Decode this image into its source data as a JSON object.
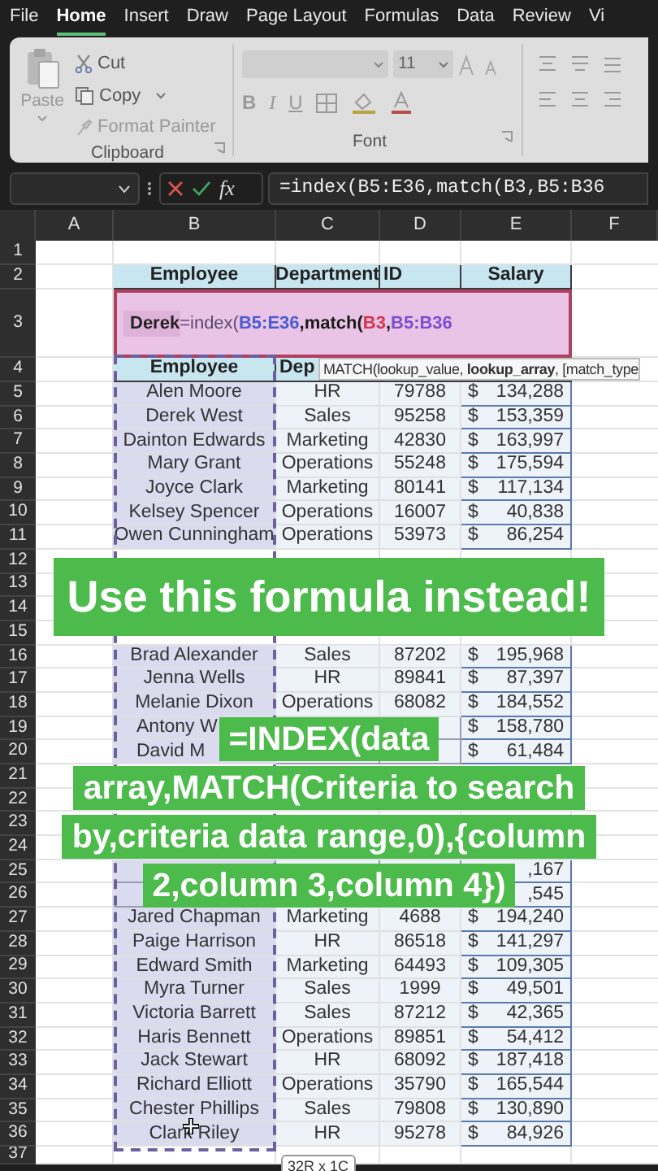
{
  "menu_tabs": [
    {
      "label": "File",
      "selected": false
    },
    {
      "label": "Home",
      "selected": true
    },
    {
      "label": "Insert",
      "selected": false
    },
    {
      "label": "Draw",
      "selected": false
    },
    {
      "label": "Page Layout",
      "selected": false
    },
    {
      "label": "Formulas",
      "selected": false
    },
    {
      "label": "Data",
      "selected": false
    },
    {
      "label": "Review",
      "selected": false
    },
    {
      "label": "Vi",
      "selected": false
    }
  ],
  "ribbon": {
    "clipboard": {
      "paste": "Paste",
      "cut": "Cut",
      "copy": "Copy",
      "format_painter": "Format Painter",
      "label": "Clipboard"
    },
    "font": {
      "size": "11",
      "bold": "B",
      "italic": "I",
      "underline": "U",
      "label": "Font"
    }
  },
  "formula_bar": {
    "function_label": "fx",
    "formula": "=index(B5:E36,match(B3,B5:B36"
  },
  "column_headers": [
    "A",
    "B",
    "C",
    "D",
    "E",
    "F"
  ],
  "rows": [
    {
      "number": "1",
      "kind": "blank"
    },
    {
      "number": "2",
      "kind": "header",
      "cells": [
        "Employee",
        "Department",
        "ID",
        "Salary"
      ]
    },
    {
      "number": "3",
      "kind": "edit",
      "value": "Derek",
      "tokens": [
        {
          "text": "=index(",
          "color": "#5b4a6e",
          "bold": false
        },
        {
          "text": "B5:E36",
          "color": "#4b5bd0",
          "bold": true
        },
        {
          "text": ",match(",
          "color": "#1a1a1a",
          "bold": true
        },
        {
          "text": "B3",
          "color": "#d6344f",
          "bold": true
        },
        {
          "text": ",",
          "color": "#1a1a1a",
          "bold": true
        },
        {
          "text": "B5:B36",
          "color": "#7a4fd0",
          "bold": true
        }
      ]
    },
    {
      "number": "4",
      "kind": "header",
      "cells": [
        "Employee",
        "Dep"
      ]
    },
    {
      "number": "5",
      "kind": "data",
      "employee": "Alen Moore",
      "department": "HR",
      "id": "79788",
      "currency": "$",
      "salary": "134,288"
    },
    {
      "number": "6",
      "kind": "data",
      "employee": "Derek West",
      "department": "Sales",
      "id": "95258",
      "currency": "$",
      "salary": "153,359"
    },
    {
      "number": "7",
      "kind": "data",
      "employee": "Dainton Edwards",
      "department": "Marketing",
      "id": "42830",
      "currency": "$",
      "salary": "163,997"
    },
    {
      "number": "8",
      "kind": "data",
      "employee": "Mary Grant",
      "department": "Operations",
      "id": "55248",
      "currency": "$",
      "salary": "175,594"
    },
    {
      "number": "9",
      "kind": "data",
      "employee": "Joyce Clark",
      "department": "Marketing",
      "id": "80141",
      "currency": "$",
      "salary": "117,134"
    },
    {
      "number": "10",
      "kind": "data",
      "employee": "Kelsey Spencer",
      "department": "Operations",
      "id": "16007",
      "currency": "$",
      "salary": "40,838"
    },
    {
      "number": "11",
      "kind": "data",
      "employee": "Owen Cunningham",
      "department": "Operations",
      "id": "53973",
      "currency": "$",
      "salary": "86,254"
    },
    {
      "number": "12",
      "kind": "blank"
    },
    {
      "number": "13",
      "kind": "blank"
    },
    {
      "number": "14",
      "kind": "blank"
    },
    {
      "number": "15",
      "kind": "blank"
    },
    {
      "number": "16",
      "kind": "data",
      "employee": "Brad Alexander",
      "department": "Sales",
      "id": "87202",
      "currency": "$",
      "salary": "195,968"
    },
    {
      "number": "17",
      "kind": "data",
      "employee": "Jenna Wells",
      "department": "HR",
      "id": "89841",
      "currency": "$",
      "salary": "87,397"
    },
    {
      "number": "18",
      "kind": "data",
      "employee": "Melanie Dixon",
      "department": "Operations",
      "id": "68082",
      "currency": "$",
      "salary": "184,552"
    },
    {
      "number": "19",
      "kind": "partial",
      "employee": "Antony W",
      "currency": "$",
      "salary": "158,780"
    },
    {
      "number": "20",
      "kind": "partial",
      "employee": "David M",
      "currency": "$",
      "salary": "61,484"
    },
    {
      "number": "21",
      "kind": "blank"
    },
    {
      "number": "22",
      "kind": "blank"
    },
    {
      "number": "23",
      "kind": "blank"
    },
    {
      "number": "24",
      "kind": "blank"
    },
    {
      "number": "25",
      "kind": "partial",
      "salary": ",167"
    },
    {
      "number": "26",
      "kind": "partial",
      "salary": ",545"
    },
    {
      "number": "27",
      "kind": "data",
      "employee": "Jared Chapman",
      "department": "Marketing",
      "id": "4688",
      "currency": "$",
      "salary": "194,240"
    },
    {
      "number": "28",
      "kind": "data",
      "employee": "Paige Harrison",
      "department": "HR",
      "id": "86518",
      "currency": "$",
      "salary": "141,297"
    },
    {
      "number": "29",
      "kind": "data",
      "employee": "Edward Smith",
      "department": "Marketing",
      "id": "64493",
      "currency": "$",
      "salary": "109,305"
    },
    {
      "number": "30",
      "kind": "data",
      "employee": "Myra Turner",
      "department": "Sales",
      "id": "1999",
      "currency": "$",
      "salary": "49,501"
    },
    {
      "number": "31",
      "kind": "data",
      "employee": "Victoria Barrett",
      "department": "Sales",
      "id": "87212",
      "currency": "$",
      "salary": "42,365"
    },
    {
      "number": "32",
      "kind": "data",
      "employee": "Haris Bennett",
      "department": "Operations",
      "id": "89851",
      "currency": "$",
      "salary": "54,412"
    },
    {
      "number": "33",
      "kind": "data",
      "employee": "Jack Stewart",
      "department": "HR",
      "id": "68092",
      "currency": "$",
      "salary": "187,418"
    },
    {
      "number": "34",
      "kind": "data",
      "employee": "Richard Elliott",
      "department": "Operations",
      "id": "35790",
      "currency": "$",
      "salary": "165,544"
    },
    {
      "number": "35",
      "kind": "data",
      "employee": "Chester Phillips",
      "department": "Sales",
      "id": "79808",
      "currency": "$",
      "salary": "130,890"
    },
    {
      "number": "36",
      "kind": "data",
      "employee": "Clark Riley",
      "department": "HR",
      "id": "95278",
      "currency": "$",
      "salary": "84,926"
    },
    {
      "number": "37",
      "kind": "blank"
    }
  ],
  "tooltip": "MATCH(lookup_value, **lookup_array**, [match_type",
  "selection_size": "32R x 1C",
  "caption_top": "Use this formula instead!",
  "caption_bottom": [
    "=INDEX(data",
    "array,MATCH(Criteria to search",
    "by,criteria data range,0),{column",
    "2,column 3,column 4})"
  ]
}
